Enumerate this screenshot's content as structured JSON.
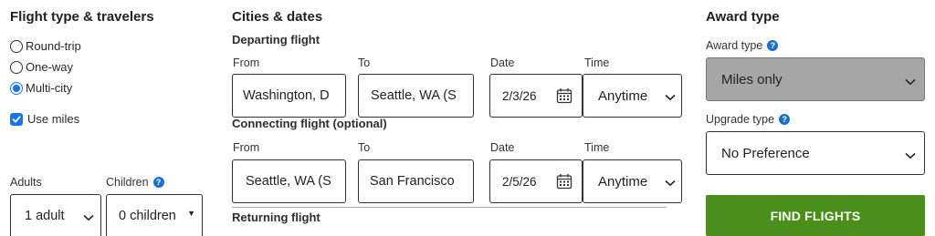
{
  "travelers_section": {
    "title": "Flight type & travelers",
    "trip_types": [
      {
        "label": "Round-trip",
        "selected": false
      },
      {
        "label": "One-way",
        "selected": false
      },
      {
        "label": "Multi-city",
        "selected": true
      }
    ],
    "use_miles": {
      "label": "Use miles",
      "checked": true
    },
    "adults": {
      "label": "Adults",
      "value": "1 adult"
    },
    "children": {
      "label": "Children",
      "value": "0 children"
    }
  },
  "cities_section": {
    "title": "Cities & dates",
    "departing": {
      "heading": "Departing flight",
      "from_label": "From",
      "to_label": "To",
      "date_label": "Date",
      "time_label": "Time",
      "from_value": "Washington, D",
      "to_value": "Seattle, WA (S",
      "date_value": "2/3/26",
      "time_value": "Anytime"
    },
    "connecting": {
      "heading": "Connecting flight (optional)",
      "from_label": "From",
      "to_label": "To",
      "date_label": "Date",
      "time_label": "Time",
      "from_value": "Seattle, WA (S",
      "to_value": "San Francisco",
      "date_value": "2/5/26",
      "time_value": "Anytime"
    },
    "returning": {
      "heading": "Returning flight"
    }
  },
  "award_section": {
    "title": "Award type",
    "award_type": {
      "label": "Award type",
      "value": "Miles only"
    },
    "upgrade_type": {
      "label": "Upgrade type",
      "value": "No Preference"
    },
    "find_button": "FIND FLIGHTS"
  },
  "colors": {
    "accent_blue": "#1a73e8",
    "find_button_green": "#4a8f1c",
    "disabled_select_gray": "#a6a6a6"
  }
}
